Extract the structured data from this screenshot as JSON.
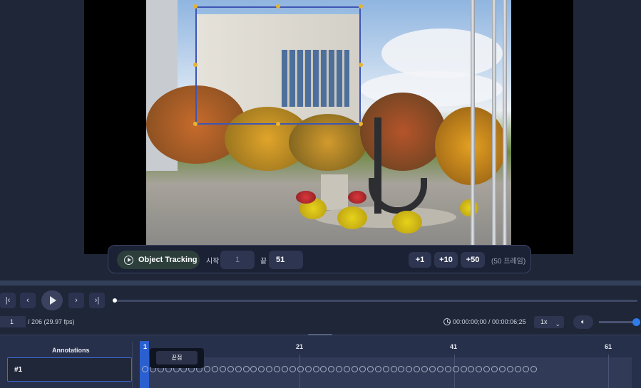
{
  "tracking": {
    "mode_label": "Object Tracking",
    "start_label": "시작",
    "start_value": "1",
    "end_label": "끝",
    "end_value": "51",
    "step_buttons": [
      "+1",
      "+10",
      "+50"
    ],
    "frames_note": "(50 프레임)"
  },
  "transport": {
    "first_icon": "skip-first-icon",
    "prev_icon": "previous-frame-icon",
    "play_icon": "play-icon",
    "next_icon": "next-frame-icon",
    "last_icon": "skip-last-icon",
    "first_glyph": "|‹",
    "prev_glyph": "‹",
    "next_glyph": "›",
    "last_glyph": "›|",
    "progress": 0.0
  },
  "status": {
    "frame_value": "1",
    "frame_total": "/ 206 (29.97 fps)",
    "timecode": "00:00:00;00 / 00:00:06;25",
    "speed": "1x",
    "volume_icon": "speaker-icon",
    "volume_level": 1.0
  },
  "timeline": {
    "annotations_header": "Annotations",
    "annotation_item": "#1",
    "current_frame": "1",
    "ticks": [
      "21",
      "41",
      "61"
    ],
    "tooltip": "끝점",
    "keyframe_count": 51
  },
  "colors": {
    "accent": "#2f7bea",
    "bbox": "#3e56b5",
    "handle": "#e6b431",
    "cursor": "#2b5fcf"
  }
}
